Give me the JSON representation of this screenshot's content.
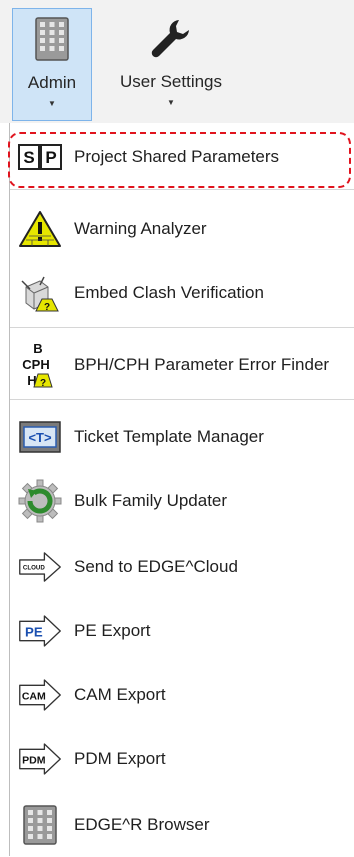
{
  "ribbon": {
    "admin_label": "Admin",
    "user_settings_label": "User Settings"
  },
  "menu": {
    "items": [
      {
        "label": "Project Shared Parameters",
        "icon": "shared-parameters-icon"
      },
      {
        "label": "Warning Analyzer",
        "icon": "warning-triangle-icon"
      },
      {
        "label": "Embed Clash Verification",
        "icon": "clash-verification-icon"
      },
      {
        "label": "BPH/CPH Parameter Error Finder",
        "icon": "bph-cph-icon"
      },
      {
        "label": "Ticket Template Manager",
        "icon": "ticket-template-icon"
      },
      {
        "label": "Bulk Family Updater",
        "icon": "gear-refresh-icon"
      },
      {
        "label": "Send to EDGE^Cloud",
        "icon": "cloud-arrow-icon"
      },
      {
        "label": "PE Export",
        "icon": "pe-arrow-icon"
      },
      {
        "label": "CAM Export",
        "icon": "cam-arrow-icon"
      },
      {
        "label": "PDM Export",
        "icon": "pdm-arrow-icon"
      },
      {
        "label": "EDGE^R Browser",
        "icon": "edge-browser-icon"
      }
    ],
    "icon_text": {
      "sp_s": "S",
      "sp_p": "P",
      "bph_b": "B",
      "bph_cph": "CPH",
      "bph_h": "H",
      "bph_q": "?",
      "ticket": "<T>",
      "cloud": "CLOUD",
      "pe": "PE",
      "cam": "CAM",
      "pdm": "PDM"
    }
  },
  "colors": {
    "highlight": "#e0141e",
    "selected_ribbon": "#cfe4f7",
    "warning_yellow": "#e6e600"
  }
}
